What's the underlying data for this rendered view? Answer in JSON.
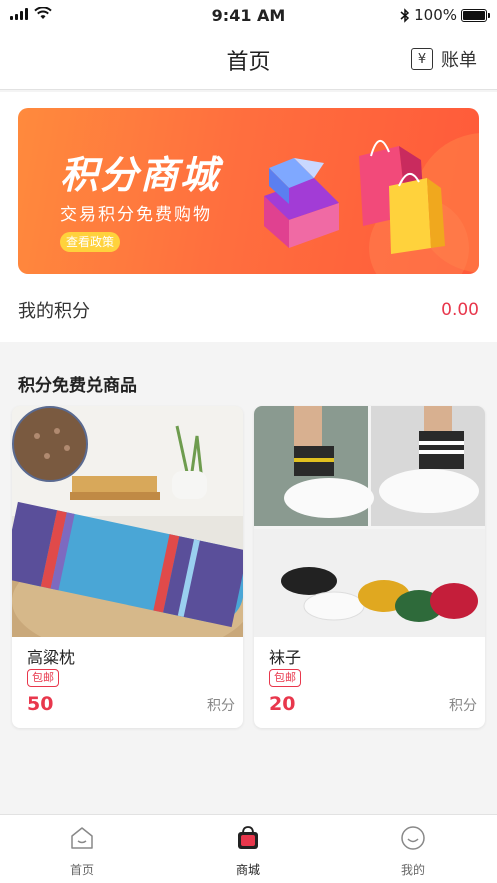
{
  "status_bar": {
    "time": "9:41 AM",
    "battery": "100%"
  },
  "nav": {
    "title": "首页",
    "bill_label": "账单",
    "bill_icon": "yen-icon"
  },
  "banner": {
    "title": "积分商城",
    "subtitle": "交易积分免费购物",
    "cta": "查看政策"
  },
  "my_points": {
    "label": "我的积分",
    "value": "0.00"
  },
  "section": {
    "title": "积分免费兑商品"
  },
  "products": [
    {
      "name": "高粱枕",
      "badge": "包邮",
      "price": "50",
      "unit": "积分"
    },
    {
      "name": "袜子",
      "badge": "包邮",
      "price": "20",
      "unit": "积分"
    }
  ],
  "tabs": [
    {
      "label": "首页",
      "icon": "home-icon",
      "active": false
    },
    {
      "label": "商城",
      "icon": "shopping-bag-icon",
      "active": true
    },
    {
      "label": "我的",
      "icon": "smile-icon",
      "active": false
    }
  ],
  "colors": {
    "accent": "#e8374c",
    "banner": "#ff6f3e"
  }
}
